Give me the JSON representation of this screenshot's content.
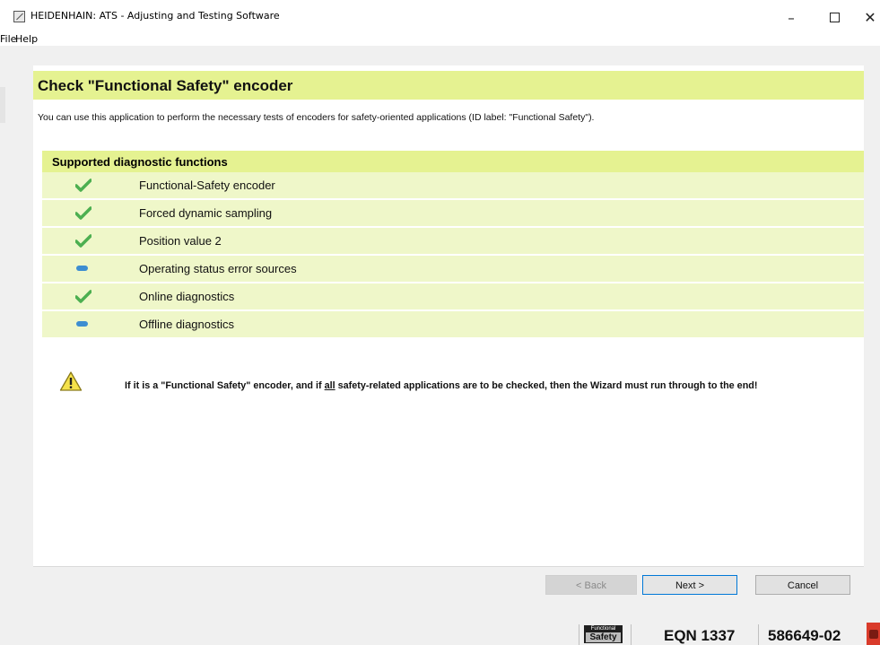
{
  "window": {
    "title": "HEIDENHAIN: ATS - Adjusting and Testing Software",
    "minimize_icon": "minimize-icon",
    "maximize_icon": "maximize-icon",
    "close_icon": "close-icon"
  },
  "menu": {
    "items": [
      {
        "label": "File"
      },
      {
        "label": "Help"
      }
    ]
  },
  "panel": {
    "title": "Check \"Functional Safety\" encoder",
    "intro": "You can use this application to perform the necessary tests of encoders for safety-oriented applications (ID label: \"Functional Safety\")."
  },
  "diagnostics": {
    "header": "Supported diagnostic functions",
    "rows": [
      {
        "label": "Functional-Safety encoder",
        "status": "check-icon"
      },
      {
        "label": "Forced dynamic sampling",
        "status": "check-icon"
      },
      {
        "label": "Position value 2",
        "status": "check-icon"
      },
      {
        "label": "Operating status error sources",
        "status": "dash-icon"
      },
      {
        "label": "Online diagnostics",
        "status": "check-icon"
      },
      {
        "label": "Offline diagnostics",
        "status": "dash-icon"
      }
    ]
  },
  "warning": {
    "icon": "warning-icon",
    "text_before": "If it is a \"Functional Safety\" encoder, and if ",
    "text_underlined": "all",
    "text_after": " safety-related applications are to be checked, then the Wizard must run through to the end!"
  },
  "buttons": {
    "back": "< Back",
    "next": "Next >",
    "cancel": "Cancel"
  },
  "statusbar": {
    "badge_line1": "Functional",
    "badge_line2": "Safety",
    "model": "EQN 1337",
    "id_number": "586649-02"
  },
  "colors": {
    "header_green": "#e5f291",
    "row_green": "#eff7c9",
    "check_green": "#4caf50",
    "dash_blue": "#3d8ed1",
    "focus_blue": "#0078d7"
  }
}
